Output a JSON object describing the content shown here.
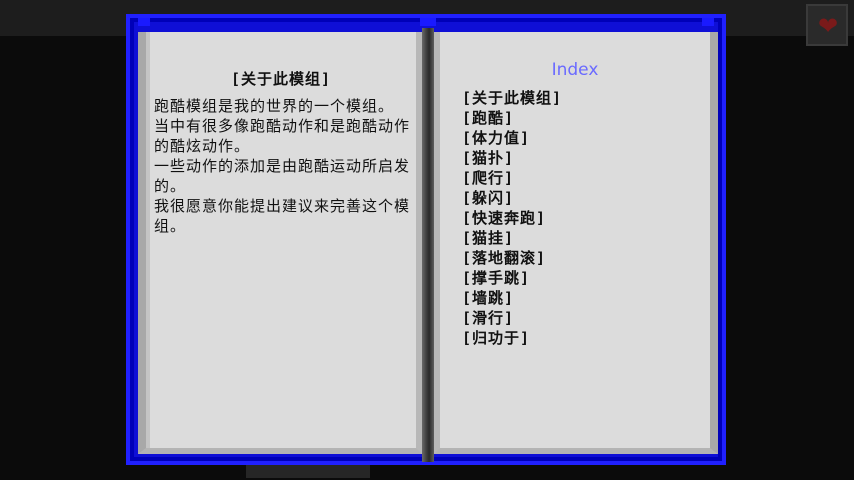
{
  "hud": {
    "icon": "heart-icon",
    "icon_color": "#7a1a1a"
  },
  "book": {
    "frame_color": "#0f0fd6",
    "page_color": "#dcdcdc",
    "left_page": {
      "title": "[关于此模组]",
      "paragraphs": [
        "跑酷模组是我的世界的一个模组。",
        "当中有很多像跑酷动作和是跑酷动作的酷炫动作。",
        "一些动作的添加是由跑酷运动所启发的。",
        "我很愿意你能提出建议来完善这个模组。"
      ]
    },
    "right_page": {
      "title": "Index",
      "title_color": "#6a6aff",
      "items": [
        "[关于此模组]",
        "[跑酷]",
        "[体力值]",
        "[猫扑]",
        "[爬行]",
        "[躲闪]",
        "[快速奔跑]",
        "[猫挂]",
        "[落地翻滚]",
        "[撑手跳]",
        "[墙跳]",
        "[滑行]",
        "[归功于]"
      ]
    }
  }
}
